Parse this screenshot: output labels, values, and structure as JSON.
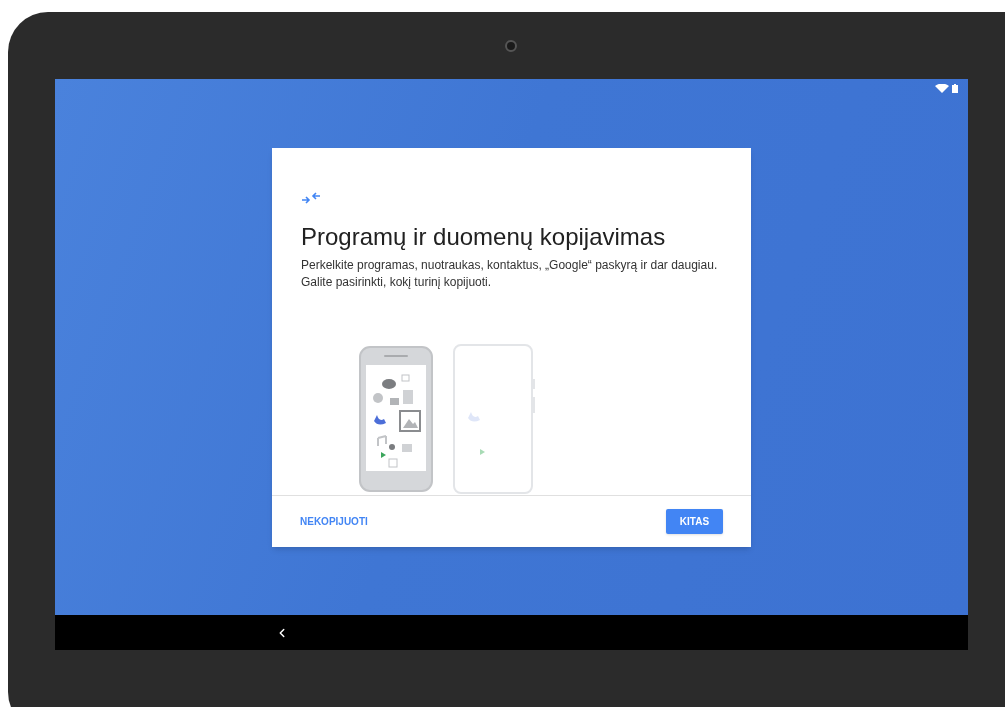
{
  "dialog": {
    "title": "Programų ir duomenų kopijavimas",
    "description": [
      "Perkelkite programas, nuotraukas, kontaktus, „Google“ paskyrą ir dar daugiau.",
      "Galite pasirinkti, kokį turinį kopijuoti."
    ],
    "buttons": [
      {
        "label": "NEKOPIJUOTI",
        "kind": "text"
      },
      {
        "label": "KITAS",
        "kind": "filled"
      }
    ]
  }
}
